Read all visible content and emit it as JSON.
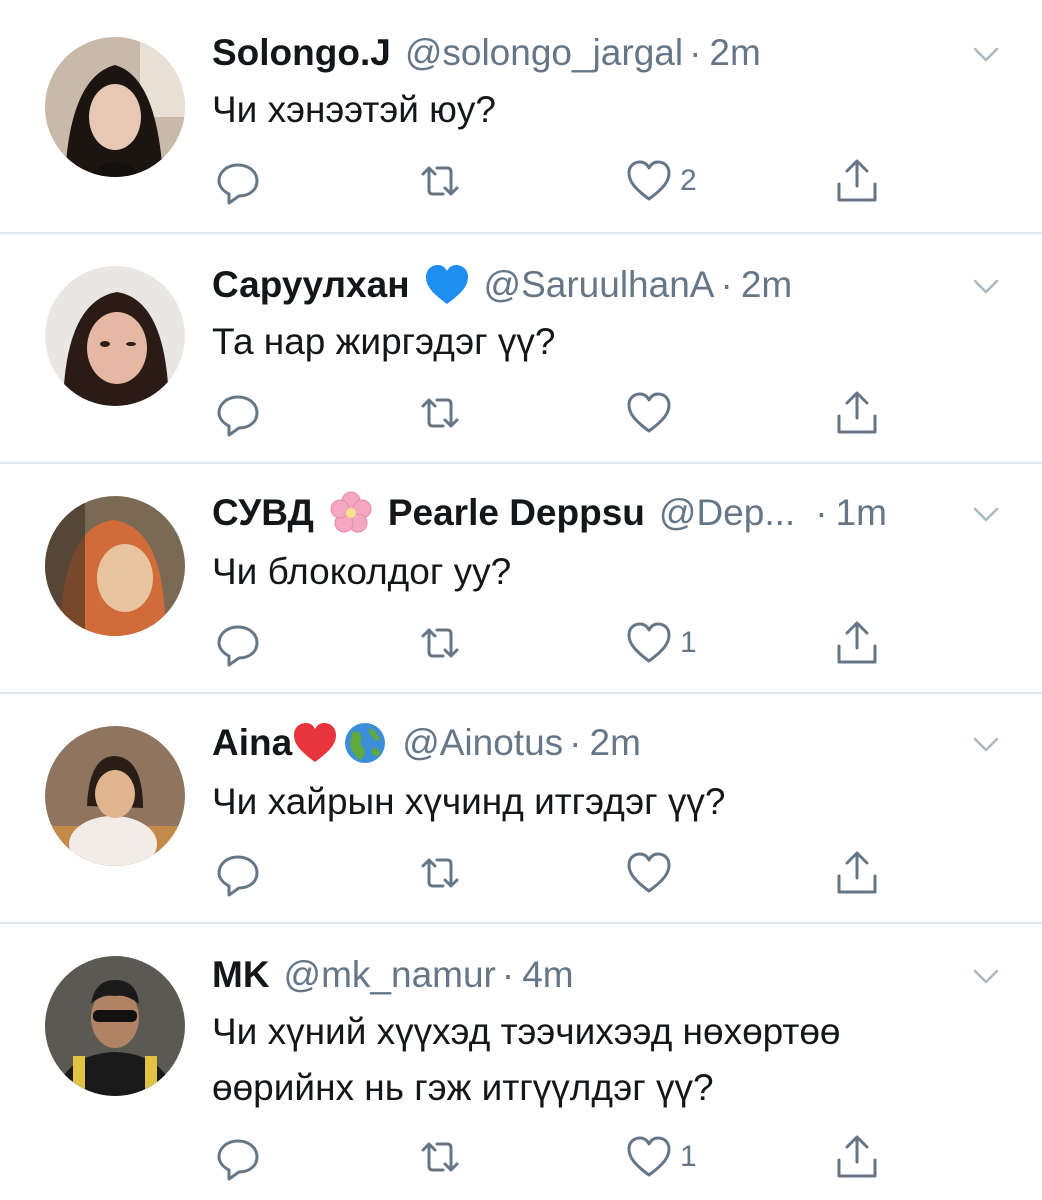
{
  "tweets": [
    {
      "name": "Solongo.J",
      "handle": "@solongo_jargal",
      "dot": "·",
      "time": "2m",
      "text": "Чи хэнээтэй юу?",
      "likes": "2",
      "avatar_colors": [
        "#c9b9a8",
        "#1c1410",
        "#e8c8b4"
      ]
    },
    {
      "name": "Саруулхан",
      "handle": "@SaruulhanA",
      "dot": "·",
      "time": "2m",
      "text": "Та нар жиргэдэг үү?",
      "likes": "",
      "badge": "blue-heart-emoji",
      "avatar_colors": [
        "#e9e6e4",
        "#2a1b17",
        "#e6b7a3"
      ]
    },
    {
      "name": "СУВД",
      "name2": "Pearle Deppsu",
      "handle": "@Dep...",
      "dot": "·",
      "time": "1m",
      "text": "Чи блоколдог уу?",
      "likes": "1",
      "badge": "cherry-blossom-emoji",
      "avatar_colors": [
        "#7a6a54",
        "#d16c3a",
        "#e9c4a0"
      ]
    },
    {
      "name": "Aina",
      "handle": "@Ainotus",
      "dot": "·",
      "time": "2m",
      "text": "Чи хайрын хүчинд итгэдэг үү?",
      "likes": "",
      "badge": "red-heart-emoji, globe-emoji",
      "avatar_colors": [
        "#8f7560",
        "#2a1d16",
        "#f1ece6"
      ]
    },
    {
      "name": "MK",
      "handle": "@mk_namur",
      "dot": "·",
      "time": "4m",
      "text_line1": "Чи хүний хүүхэд тээчихээд нөхөртөө",
      "text_line2": "өөрийнх нь гэж итгүүлдэг үү?",
      "likes": "1",
      "avatar_colors": [
        "#5b5a52",
        "#1a1a1a",
        "#e0c341"
      ]
    }
  ],
  "colors": {
    "text": "#14171a",
    "secondary": "#657786",
    "divider": "#e1e8ed",
    "icon": "#657786"
  },
  "icons": [
    "reply-icon",
    "retweet-icon",
    "like-icon",
    "share-icon",
    "chevron-down-icon"
  ]
}
